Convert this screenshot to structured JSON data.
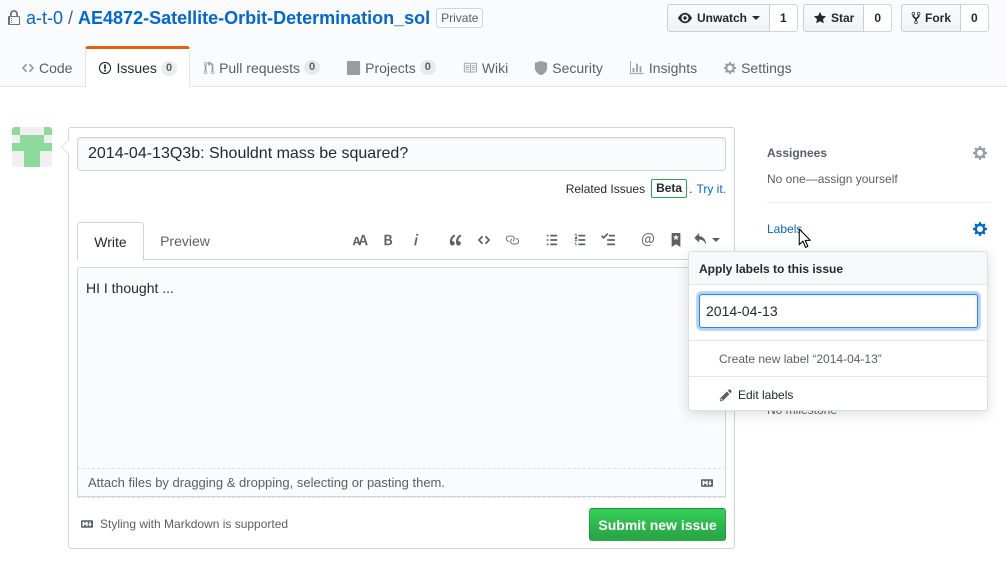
{
  "repo": {
    "owner": "a-t-0",
    "separator": "/",
    "name": "AE4872-Satellite-Orbit-Determination_sol",
    "visibility": "Private"
  },
  "actions": {
    "watch_label": "Unwatch",
    "watch_count": "1",
    "star_label": "Star",
    "star_count": "0",
    "fork_label": "Fork",
    "fork_count": "0"
  },
  "nav": {
    "code": "Code",
    "issues": "Issues",
    "issues_count": "0",
    "pulls": "Pull requests",
    "pulls_count": "0",
    "projects": "Projects",
    "projects_count": "0",
    "wiki": "Wiki",
    "security": "Security",
    "insights": "Insights",
    "settings": "Settings"
  },
  "issue_form": {
    "title_value": "2014-04-13Q3b: Shouldnt mass be squared?",
    "related_text": "Related Issues",
    "beta_badge": "Beta",
    "related_sep": ".",
    "try_link": "Try it.",
    "tab_write": "Write",
    "tab_preview": "Preview",
    "body_value": "HI I thought ...",
    "attach_text": "Attach files by dragging & dropping, selecting or pasting them.",
    "markdown_note": "Styling with Markdown is supported",
    "submit_label": "Submit new issue"
  },
  "sidebar": {
    "assignees_heading": "Assignees",
    "assignees_value": "No one—assign yourself",
    "labels_heading": "Labels",
    "milestone_value": "No milestone"
  },
  "labels_menu": {
    "header": "Apply labels to this issue",
    "filter_value": "2014-04-13",
    "create_item": "Create new label “2014-04-13”",
    "edit_item": "Edit labels"
  },
  "colors": {
    "link": "#0366d6",
    "accent_tab": "#e36209",
    "submit_green": "#28a745",
    "avatar_green": "#8ed99c"
  },
  "icons": [
    "lock-icon",
    "eye-icon",
    "star-icon",
    "fork-icon",
    "code-icon",
    "issue-icon",
    "pull-request-icon",
    "project-icon",
    "book-icon",
    "shield-icon",
    "graph-icon",
    "gear-icon",
    "markdown-icon",
    "pencil-icon",
    "cursor-icon"
  ]
}
